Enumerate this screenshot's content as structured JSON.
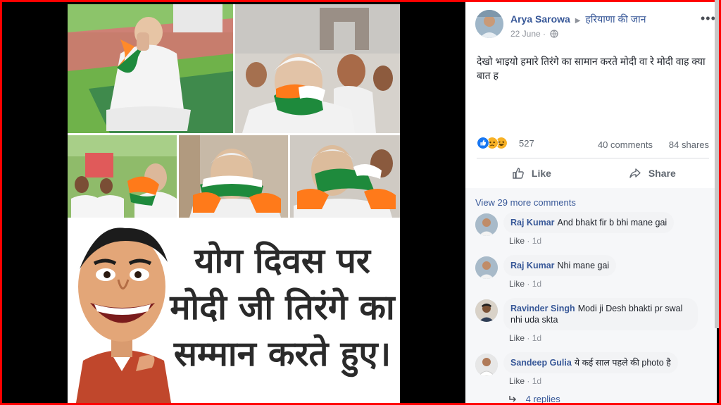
{
  "post": {
    "author": "Arya Sarowa",
    "separator_icon": "arrow-right-icon",
    "group": "हरियाणा की जान",
    "date": "22 June",
    "privacy_icon": "globe-icon",
    "menu_label": "•••",
    "text": "देखो भाइयो हमारे तिरंगे का सामान करते मोदी वा रे मोदी वाह क्या बात ह"
  },
  "image": {
    "caption_lines": [
      "योग दिवस पर",
      "मोदी जी तिरंगे का",
      "सम्मान करते हुए।"
    ]
  },
  "stats": {
    "reaction_icons": [
      "like-icon",
      "sad-icon",
      "haha-icon"
    ],
    "reaction_count": "527",
    "comments": "40 comments",
    "shares": "84 shares"
  },
  "actions": {
    "like": "Like",
    "share": "Share"
  },
  "comments": {
    "view_more": "View 29 more comments",
    "items": [
      {
        "name": "Raj Kumar",
        "text": "And bhakt fir b bhi mane gai",
        "like": "Like",
        "sep": "·",
        "time": "1d"
      },
      {
        "name": "Raj Kumar",
        "text": "Nhi mane gai",
        "like": "Like",
        "sep": "·",
        "time": "1d"
      },
      {
        "name": "Ravinder Singh",
        "text": "Modi ji Desh bhakti pr swal nhi uda skta",
        "like": "Like",
        "sep": "·",
        "time": "1d"
      },
      {
        "name": "Sandeep Gulia",
        "text": "ये कई साल पहले की photo है",
        "like": "Like",
        "sep": "·",
        "time": "1d"
      }
    ],
    "replies": "4 replies",
    "replies_icon": "reply-arrow-icon"
  },
  "colors": {
    "border": "#ff0000",
    "fb_blue": "#385898",
    "muted": "#90949c",
    "saffron": "#ff7a1a",
    "green": "#1e8a3c"
  }
}
